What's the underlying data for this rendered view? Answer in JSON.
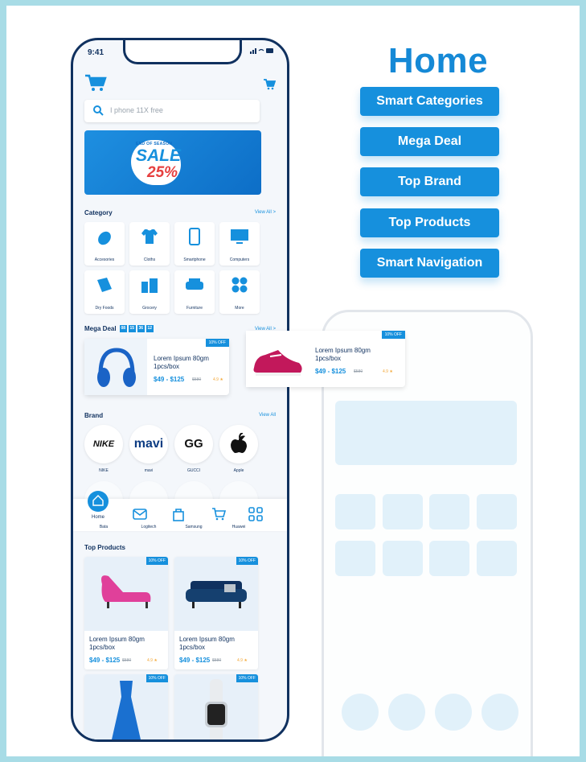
{
  "heading": {
    "title": "Home"
  },
  "features": [
    "Smart Categories",
    "Mega Deal",
    "Top Brand",
    "Top Products",
    "Smart Navigation"
  ],
  "status": {
    "time": "9:41"
  },
  "search": {
    "placeholder": "I phone 11X free"
  },
  "banner": {
    "eyebrow": "END OF SEASON",
    "sale": "SALE",
    "discount": "25%"
  },
  "category": {
    "title": "Category",
    "view_all": "View All >",
    "items": [
      {
        "label": "Accesories",
        "icon": "mouse-icon"
      },
      {
        "label": "Cloths",
        "icon": "shirt-icon"
      },
      {
        "label": "Smartphone",
        "icon": "smartphone-icon"
      },
      {
        "label": "Computers",
        "icon": "monitor-icon"
      },
      {
        "label": "Dry Foods",
        "icon": "dry-foods-icon"
      },
      {
        "label": "Grocery",
        "icon": "grocery-icon"
      },
      {
        "label": "Furniture",
        "icon": "sofa-icon"
      },
      {
        "label": "More",
        "icon": "more-grid-icon"
      }
    ]
  },
  "mega_deal": {
    "title": "Mega Deal",
    "timer": [
      "08",
      "15",
      "36",
      "12"
    ],
    "view_all": "View All >",
    "items": [
      {
        "badge": "10% OFF",
        "title_line1": "Lorem Ipsum 80gm",
        "title_line2": "1pcs/box",
        "price": "$49 - $125",
        "old_price": "$580",
        "rating": "4.9 ★"
      },
      {
        "badge": "10% OFF",
        "title_line1": "Lorem Ipsum 80gm",
        "title_line2": "1pcs/box",
        "price": "$49 - $125",
        "old_price": "$580",
        "rating": "4.9 ★"
      }
    ]
  },
  "brand": {
    "title": "Brand",
    "view_all": "View All",
    "items": [
      {
        "label": "NIKE",
        "logo": "NIKE"
      },
      {
        "label": "mavi",
        "logo": "mavi"
      },
      {
        "label": "GUCCI",
        "logo": "GG"
      },
      {
        "label": "Apple",
        "logo": ""
      }
    ],
    "row2": [
      "Bata",
      "Logitech",
      "Samsung",
      "Huawei"
    ]
  },
  "tabbar": {
    "home_label": "Home"
  },
  "top_products": {
    "title": "Top Products",
    "items": [
      {
        "badge": "10% OFF",
        "title_line1": "Lorem Ipsum 80gm",
        "title_line2": "1pcs/box",
        "price": "$49 - $125",
        "old_price": "$580",
        "rating": "4.9 ★"
      },
      {
        "badge": "10% OFF",
        "title_line1": "Lorem Ipsum 80gm",
        "title_line2": "1pcs/box",
        "price": "$49 - $125",
        "old_price": "$580",
        "rating": "4.9 ★"
      },
      {
        "badge": "10% OFF"
      },
      {
        "badge": "10% OFF"
      }
    ]
  }
}
